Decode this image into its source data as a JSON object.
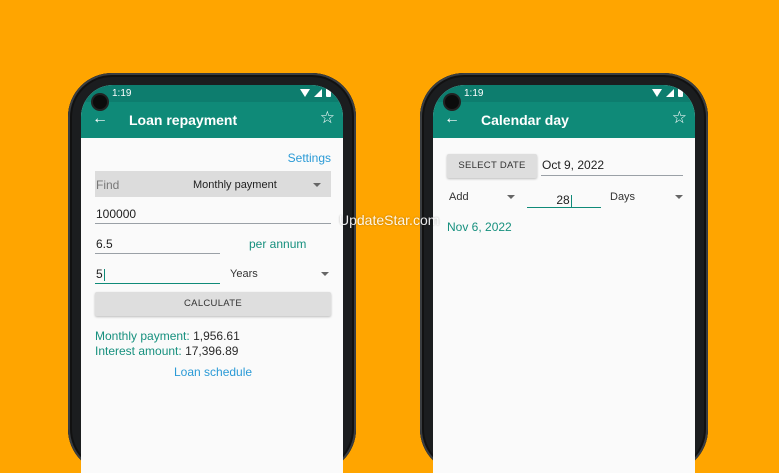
{
  "left": {
    "status": {
      "time": "1:19"
    },
    "toolbar": {
      "title": "Loan repayment"
    },
    "settings_link": "Settings",
    "find_label": "Find",
    "find_value": "Monthly payment",
    "principal": "100000",
    "rate": "6.5",
    "rate_unit": "per annum",
    "term": "5",
    "term_unit": "Years",
    "calculate_label": "CALCULATE",
    "monthly_label": "Monthly payment:",
    "monthly_value": "1,956.61",
    "interest_label": "Interest amount:",
    "interest_value": "17,396.89",
    "schedule_link": "Loan schedule"
  },
  "right": {
    "status": {
      "time": "1:19"
    },
    "toolbar": {
      "title": "Calendar day"
    },
    "select_date_label": "SELECT DATE",
    "date_value": "Oct 9, 2022",
    "operation": "Add",
    "amount": "28",
    "unit": "Days",
    "result": "Nov 6, 2022"
  },
  "watermark": "UpdateStar.com",
  "colors": {
    "background": "#FFA500",
    "toolbar": "#0f8a78",
    "accent": "#16907e",
    "link": "#2a9ad6"
  }
}
